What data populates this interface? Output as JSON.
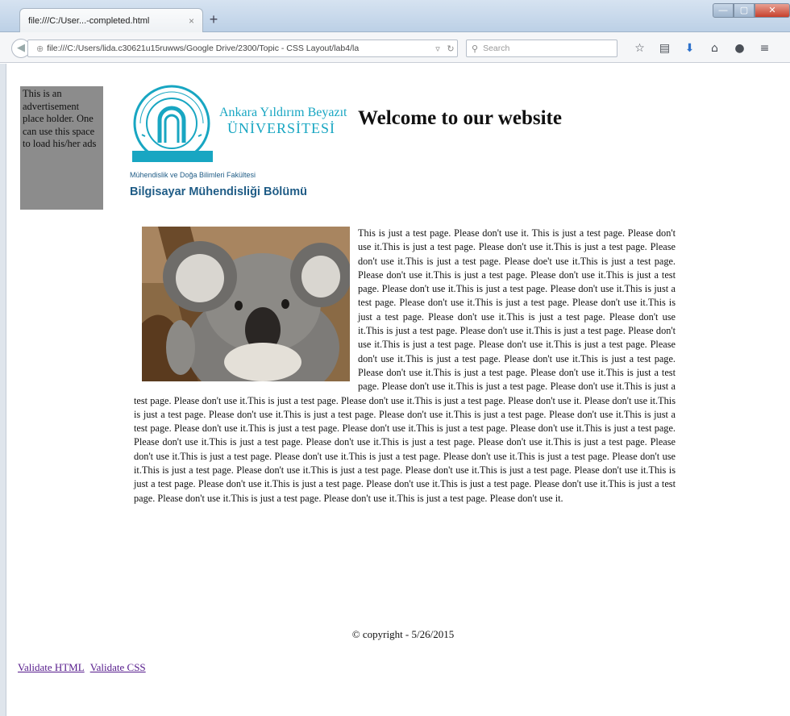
{
  "browser": {
    "tab_title": "file:///C:/User...-completed.html",
    "tab_close": "×",
    "new_tab": "+",
    "url": "file:///C:/Users/lida.c30621u15ruwws/Google Drive/2300/Topic - CSS Layout/lab4/la",
    "search_placeholder": "Search",
    "window_controls": {
      "minimize": "—",
      "maximize": "▢",
      "close": "✕"
    }
  },
  "page": {
    "ad_text": "This is an advertisement place holder. One can use this space to load his/her ads",
    "logo": {
      "name_line1": "Ankara Yıldırım Beyazıt",
      "name_line2": "ÜNİVERSİTESİ"
    },
    "faculty": "Mühendislik ve Doğa Bilimleri Fakültesi",
    "department": "Bilgisayar Mühendisliği Bölümü",
    "title": "Welcome to our website",
    "body_text": "This is just a test page. Please don't use it. This is just a test page. Please don't use it.This is just a test page. Please don't use it.This is just a test page. Please don't use it.This is just a test page. Please doe't use it.This is just a test page. Please don't use it.This is just a test page. Please don't use it.This is just a test page. Please don't use it.This is just a test page. Please don't use it.This is just a test page. Please don't use it.This is just a test page. Please don't use it.This is just a test page. Please don't use it.This is just a test page. Please don't use it.This is just a test page. Please don't use it.This is just a test page. Please don't use it.This is just a test page. Please don't use it.This is just a test page. Please don't use it.This is just a test page. Please don't use it.This is just a test page. Please don't use it.This is just a test page. Please don't use it.This is just a test page. Please don't use it.This is just a test page. Please don't use it.This is just a test page. Please don't use it.This is just a test page. Please don't use it.This is just a test page. Please don't use it. Please don't use it.This is just a test page. Please don't use it.This is just a test page. Please don't use it.This is just a test page. Please don't use it.This is just a test page. Please don't use it.This is just a test page. Please don't use it.This is just a test page. Please don't use it.This is just a test page. Please don't use it.This is just a test page. Please don't use it.This is just a test page. Please don't use it.This is just a test page. Please don't use it.This is just a test page. Please don't use it.This is just a test page. Please don't use it.This is just a test page. Please don't use it.This is just a test page. Please don't use it.This is just a test page. Please don't use it.This is just a test page. Please don't use it.This is just a test page. Please don't use it.This is just a test page. Please don't use it.This is just a test page. Please don't use it.This is just a test page. Please don't use it.This is just a test page. Please don't use it.This is just a test page. Please don't use it.",
    "copyright": "© copyright - 5/26/2015",
    "links": [
      "Validate HTML",
      "Validate CSS"
    ]
  },
  "colors": {
    "logo_teal": "#18a6c2",
    "department_blue": "#1f5c86",
    "ad_background": "#8c8c8c",
    "visited_link": "#551a8b"
  }
}
